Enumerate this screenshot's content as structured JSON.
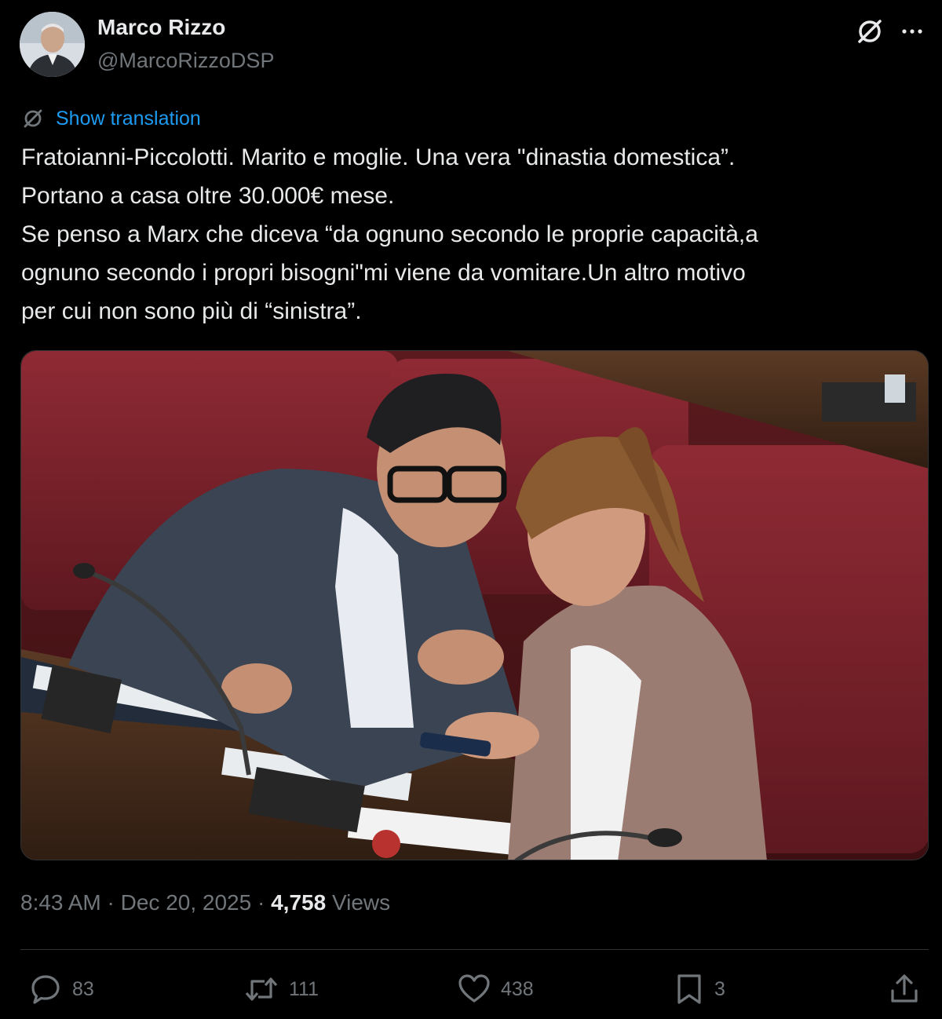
{
  "author": {
    "name": "Marco Rizzo",
    "handle": "@MarcoRizzoDSP"
  },
  "icons": {
    "grok": "grok-slash-icon",
    "more": "more-horizontal-icon",
    "translate": "translate-icon",
    "reply": "reply-icon",
    "repost": "repost-icon",
    "like": "heart-icon",
    "bookmark": "bookmark-icon",
    "share": "share-icon"
  },
  "translate_label": "Show translation",
  "tweet": {
    "lines": [
      "Fratoianni-Piccolotti. Marito e moglie. Una vera \"dinastia domestica”.",
      "Portano a casa oltre 30.000€ mese.",
      "Se penso a Marx che diceva “da ognuno secondo le proprie capacità,a",
      "ognuno secondo i propri bisogni\"mi viene da vomitare.Un altro motivo",
      "per cui non sono più di “sinistra”."
    ]
  },
  "meta": {
    "time": "8:43 AM",
    "sep1": " · ",
    "date": "Dec 20, 2025",
    "sep2": " · ",
    "views_count": "4,758",
    "views_label": " Views"
  },
  "actions": {
    "replies": "83",
    "reposts": "111",
    "likes": "438",
    "bookmarks": "3"
  },
  "colors": {
    "background": "#000000",
    "text": "#e7e9ea",
    "muted": "#71767b",
    "link": "#1d9bf0",
    "divider": "#2f3336"
  }
}
